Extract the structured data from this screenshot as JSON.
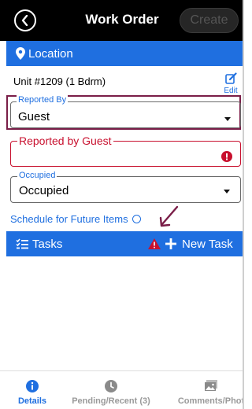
{
  "header": {
    "title": "Work Order",
    "create_label": "Create"
  },
  "location_bar": {
    "label": "Location",
    "icon": "map-marker-icon"
  },
  "unit": {
    "text": "Unit #1209 (1 Bdrm)",
    "edit_label": "Edit"
  },
  "reported_by": {
    "label": "Reported By",
    "value": "Guest"
  },
  "reported_by_guest": {
    "label": "Reported by Guest",
    "value": ""
  },
  "occupied": {
    "label": "Occupied",
    "value": "Occupied"
  },
  "schedule": {
    "label": "Schedule for Future Items"
  },
  "tasks_bar": {
    "label": "Tasks",
    "new_task_label": "New Task"
  },
  "tabs": [
    {
      "label": "Details",
      "icon": "info-icon",
      "active": true
    },
    {
      "label": "Pending/Recent (3)",
      "icon": "clock-icon",
      "active": false
    },
    {
      "label": "Comments/Phot",
      "icon": "photo-icon",
      "active": false
    }
  ],
  "colors": {
    "accent": "#1f6fe0",
    "error": "#c8102e",
    "highlight": "#7a1e48",
    "header": "#000000"
  }
}
